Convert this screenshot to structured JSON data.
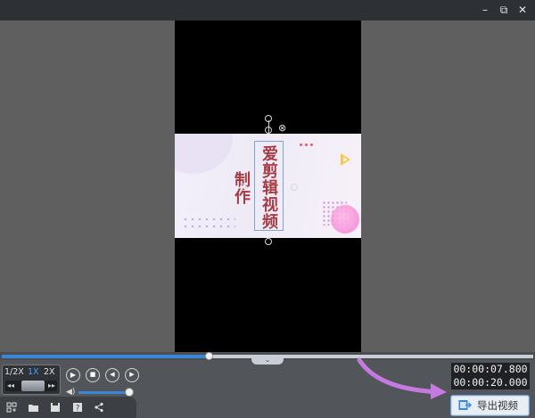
{
  "window": {
    "minimize_glyph": "–",
    "restore_glyph": "⧉",
    "close_glyph": "✕"
  },
  "preview": {
    "text_overlay": "爱剪辑视频制作",
    "delete_handle_glyph": "⊗"
  },
  "playback": {
    "speed_options": [
      "1/2X",
      "1X",
      "2X"
    ],
    "selected_speed": "1X",
    "speed_left_arrow": "◂◂",
    "speed_right_arrow": "▸▸",
    "progress_fraction": 0.39,
    "collapse_glyph": "⌄",
    "buttons": {
      "play": "▶",
      "stop": "■",
      "prev": "◀",
      "next": "▶"
    },
    "volume_glyph": "◀)",
    "volume_level": 1.0
  },
  "time": {
    "current": "00:00:07.800",
    "total": "00:00:20.000"
  },
  "toolbar": {
    "icons": [
      "import-icon",
      "open-folder-icon",
      "save-icon",
      "help-icon",
      "share-icon"
    ]
  },
  "export": {
    "label": "导出视频"
  },
  "colors": {
    "accent": "#3a87d6",
    "arrow": "#c67ae0",
    "text_overlay": "#a63b45"
  }
}
